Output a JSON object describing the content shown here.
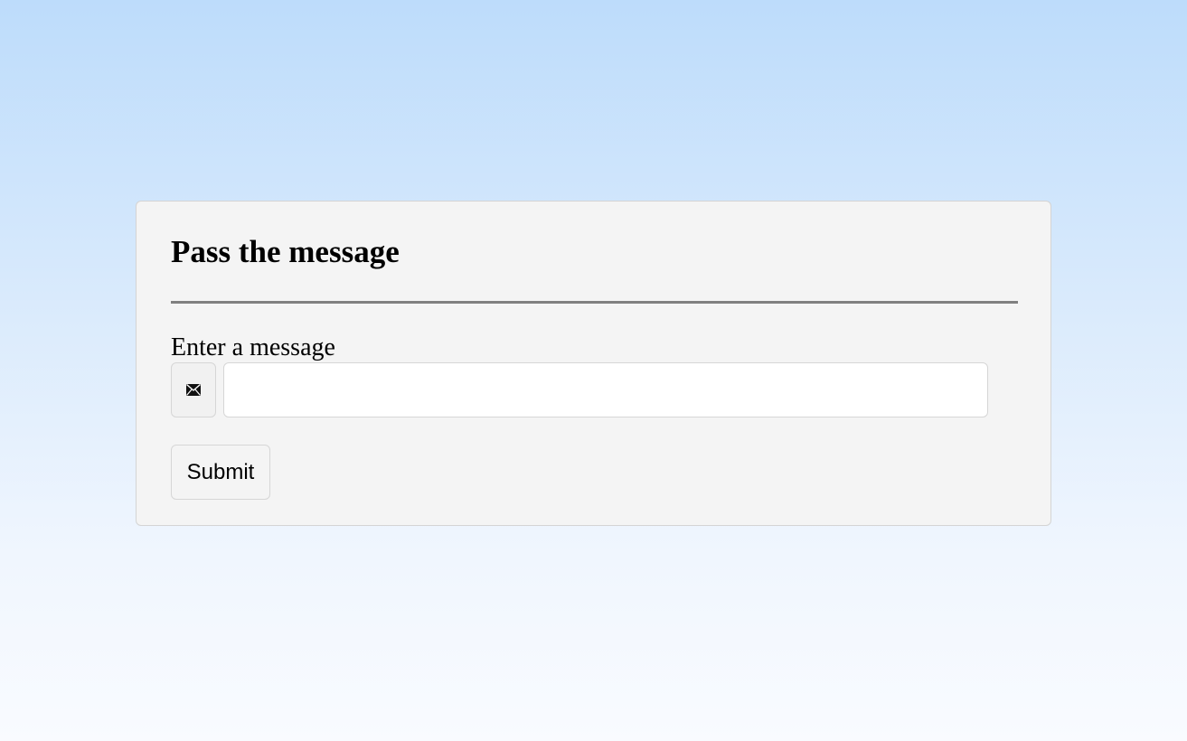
{
  "form": {
    "title": "Pass the message",
    "field_label": "Enter a message",
    "input_value": "",
    "input_placeholder": "",
    "icon": "envelope-icon",
    "submit_label": "Submit"
  },
  "colors": {
    "background_top": "#bddcfb",
    "background_bottom": "#f9fbff",
    "card_background": "#f4f4f4",
    "divider": "#808080"
  }
}
